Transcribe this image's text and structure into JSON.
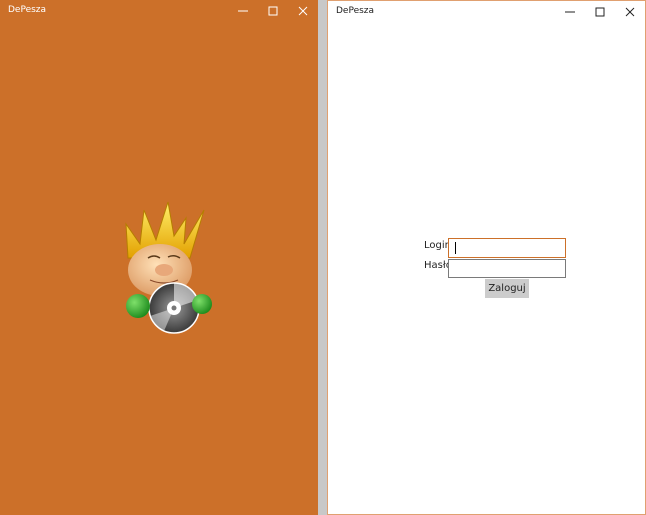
{
  "left_window": {
    "title": "DePesza",
    "background_color": "#cc7029",
    "logo_icon": "depesza-mascot-icon"
  },
  "right_window": {
    "title": "DePesza",
    "login_label": "Login",
    "password_label": "Hasło",
    "login_value": "",
    "password_value": "",
    "submit_label": "Zaloguj",
    "accent_color": "#cc7029"
  },
  "window_controls": {
    "minimize_icon": "minimize-icon",
    "maximize_icon": "maximize-icon",
    "close_icon": "close-icon"
  }
}
